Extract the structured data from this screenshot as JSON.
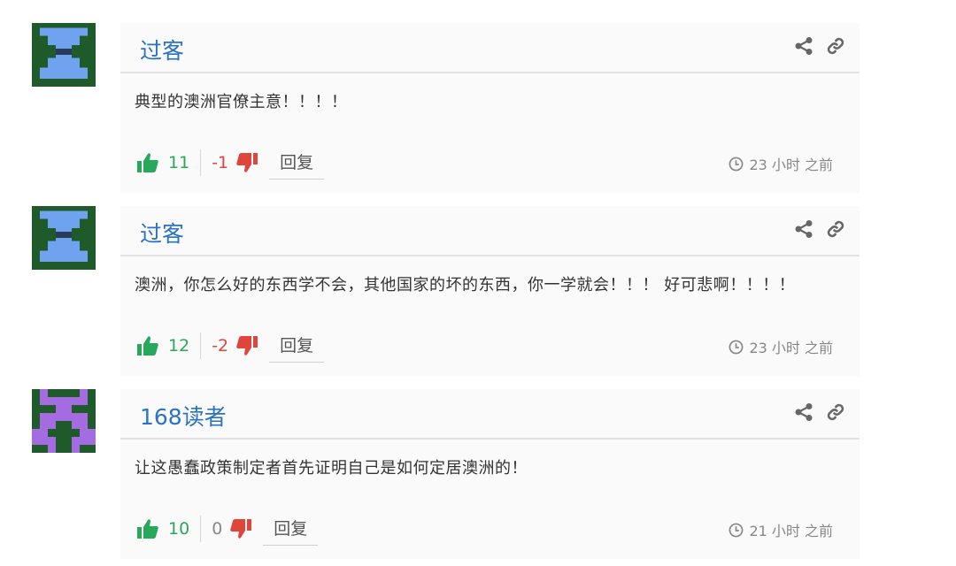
{
  "icons": {
    "share": "share-icon",
    "link": "link-icon",
    "thumbs_up": "thumbs-up-icon",
    "thumbs_down": "thumbs-down-icon",
    "clock": "clock-icon"
  },
  "colors": {
    "author": "#2a73c2",
    "upvote": "#27a85a",
    "downvote": "#e0453c",
    "neutral_count": "#888888",
    "card_background": "#fafafa"
  },
  "comments": [
    {
      "author": "过客",
      "text": "典型的澳洲官僚主意！！！！",
      "upvotes": "11",
      "downvotes": "-1",
      "reply_label": "回复",
      "time": "23 小时 之前",
      "avatar_style": "blue-hourglass"
    },
    {
      "author": "过客",
      "text": "澳洲，你怎么好的东西学不会，其他国家的坏的东西，你一学就会！！！ 好可悲啊！！！！",
      "upvotes": "12",
      "downvotes": "-2",
      "reply_label": "回复",
      "time": "23 小时 之前",
      "avatar_style": "blue-hourglass"
    },
    {
      "author": "168读者",
      "text": "让这愚蠢政策制定者首先证明自己是如何定居澳洲的！",
      "upvotes": "10",
      "downvotes": "0",
      "reply_label": "回复",
      "time": "21 小时 之前",
      "avatar_style": "purple-invader"
    }
  ]
}
